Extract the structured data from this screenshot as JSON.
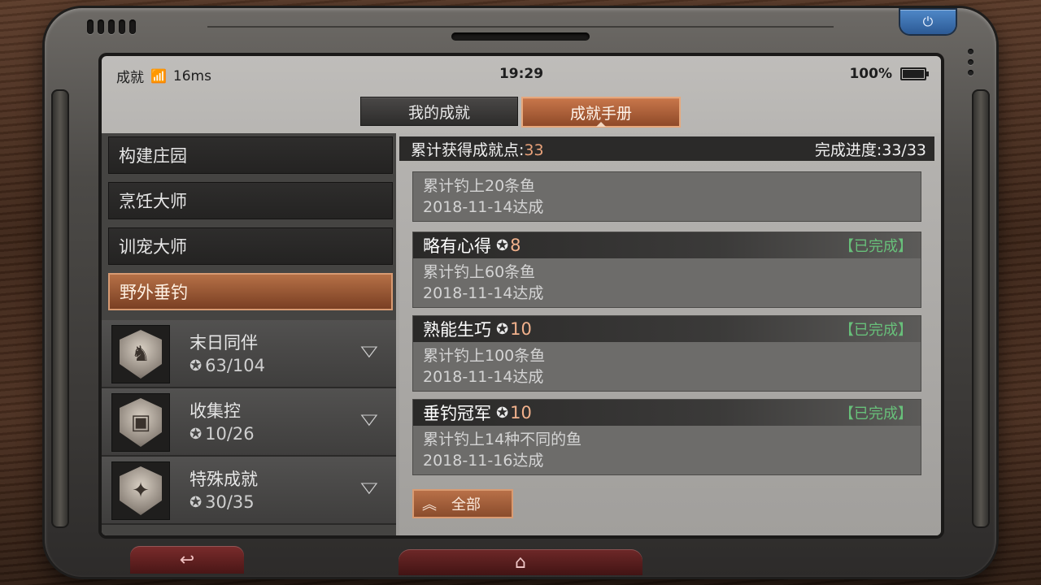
{
  "status_bar": {
    "app_name": "成就",
    "ping": "16ms",
    "time": "19:29",
    "battery": "100%"
  },
  "tabs": [
    {
      "label": "我的成就",
      "active": false
    },
    {
      "label": "成就手册",
      "active": true
    }
  ],
  "categories": [
    {
      "label": "构建庄园",
      "active": false
    },
    {
      "label": "烹饪大师",
      "active": false
    },
    {
      "label": "训宠大师",
      "active": false
    },
    {
      "label": "野外垂钓",
      "active": true
    }
  ],
  "groups": [
    {
      "name": "末日同伴",
      "points": "63/104"
    },
    {
      "name": "收集控",
      "points": "10/26"
    },
    {
      "name": "特殊成就",
      "points": "30/35"
    }
  ],
  "summary": {
    "points_label": "累计获得成就点:",
    "points_value": "33",
    "progress_label": "完成进度:",
    "progress_value": "33/33"
  },
  "achievements": [
    {
      "title": "",
      "points": "",
      "status": "",
      "desc": "累计钓上20条鱼",
      "date": "2018-11-14达成"
    },
    {
      "title": "略有心得",
      "points": "8",
      "status": "【已完成】",
      "desc": "累计钓上60条鱼",
      "date": "2018-11-14达成"
    },
    {
      "title": "熟能生巧",
      "points": "10",
      "status": "【已完成】",
      "desc": "累计钓上100条鱼",
      "date": "2018-11-14达成"
    },
    {
      "title": "垂钓冠军",
      "points": "10",
      "status": "【已完成】",
      "desc": "累计钓上14种不同的鱼",
      "date": "2018-11-16达成"
    }
  ],
  "all_button": {
    "label": "全部"
  },
  "icons": {
    "wifi": "wifi-icon",
    "battery": "battery-icon",
    "power": "power-icon",
    "medal": "medal-icon",
    "chevron": "chevron-down-icon",
    "back": "back-arrow-icon",
    "home": "home-icon"
  },
  "colors": {
    "accent": "#b87048",
    "done": "#68c07a",
    "points": "#e9a27a"
  }
}
